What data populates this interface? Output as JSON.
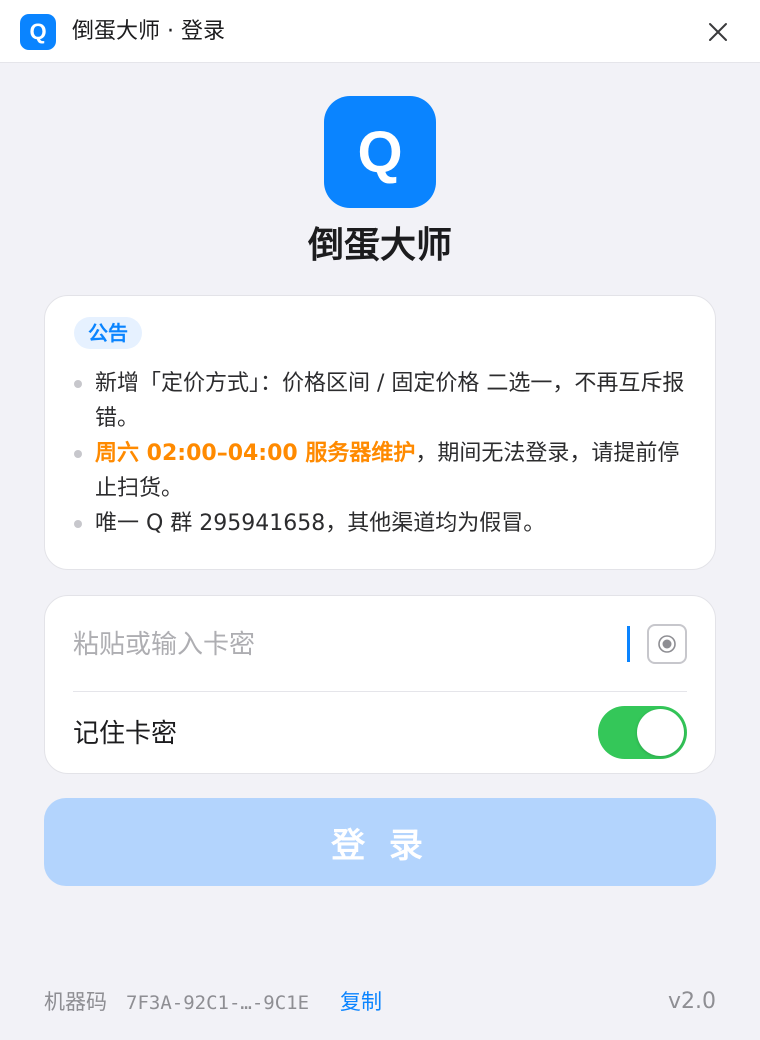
{
  "window": {
    "logo_letter": "Q",
    "title": "倒蛋大师 · 登录",
    "close_icon": "close-icon"
  },
  "app": {
    "logo_letter": "Q",
    "name": "倒蛋大师"
  },
  "notice": {
    "badge": "公告",
    "items": [
      {
        "text": "新增「定价方式」：价格区间 / 固定价格 二选一，不再互斥报错。"
      },
      {
        "highlight": "周六 02:00–04:00 服务器维护",
        "text": "，期间无法登录，请提前停止扫货。"
      },
      {
        "text": "唯一 Q 群 295941658，其他渠道均为假冒。"
      }
    ]
  },
  "form": {
    "key_placeholder": "粘贴或输入卡密",
    "key_value": "",
    "reveal_icon": "eye-icon",
    "remember_label": "记住卡密",
    "remember_enabled": true
  },
  "login_button": "登 录",
  "footer": {
    "machine_label": "机器码",
    "machine_code": "7F3A-92C1-…-9C1E",
    "copy_label": "复制",
    "version": "v2.0"
  },
  "colors": {
    "accent": "#0a84ff",
    "toggle_on": "#34c759",
    "highlight": "#ff8a00",
    "login_disabled": "#b3d4fd",
    "background": "#f2f2f7"
  }
}
